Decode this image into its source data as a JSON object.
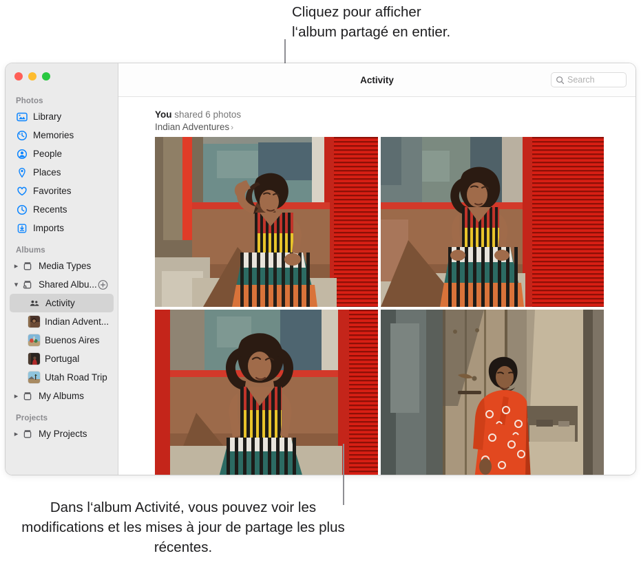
{
  "callouts": {
    "top": "Cliquez pour afficher\nl‘album partagé en entier.",
    "bottom": "Dans l‘album Activité, vous pouvez voir les modifications et les mises à jour de partage les plus récentes."
  },
  "window": {
    "traffic_lights": {
      "close": "close-button",
      "minimize": "minimize-button",
      "zoom": "zoom-button"
    }
  },
  "toolbar": {
    "title": "Activity",
    "search_placeholder": "Search",
    "search_value": ""
  },
  "sidebar": {
    "sections": [
      {
        "title": "Photos",
        "items": [
          {
            "label": "Library",
            "icon": "library-icon"
          },
          {
            "label": "Memories",
            "icon": "memories-icon"
          },
          {
            "label": "People",
            "icon": "people-icon"
          },
          {
            "label": "Places",
            "icon": "places-icon"
          },
          {
            "label": "Favorites",
            "icon": "heart-icon"
          },
          {
            "label": "Recents",
            "icon": "clock-icon"
          },
          {
            "label": "Imports",
            "icon": "import-icon"
          }
        ]
      },
      {
        "title": "Albums",
        "items": [
          {
            "label": "Media Types",
            "icon": "album-box-icon",
            "disclosure": "collapsed"
          },
          {
            "label": "Shared Albu...",
            "icon": "shared-box-icon",
            "disclosure": "expanded",
            "action": "add-shared-album-button"
          },
          {
            "label": "Activity",
            "icon": "people-pair-icon",
            "selected": true
          },
          {
            "label": "Indian Advent...",
            "icon": "album-thumbnail"
          },
          {
            "label": "Buenos Aires",
            "icon": "album-thumbnail"
          },
          {
            "label": "Portugal",
            "icon": "album-thumbnail"
          },
          {
            "label": "Utah Road Trip",
            "icon": "album-thumbnail"
          },
          {
            "label": "My Albums",
            "icon": "album-box-icon",
            "disclosure": "collapsed"
          }
        ]
      },
      {
        "title": "Projects",
        "items": [
          {
            "label": "My Projects",
            "icon": "album-box-icon",
            "disclosure": "collapsed"
          }
        ]
      }
    ]
  },
  "activity": {
    "actor": "You",
    "action": "shared 6 photos",
    "album_link": "Indian Adventures",
    "chevron": "›",
    "photos": [
      {
        "name": "photo-woman-striped-dress-hand-on-head"
      },
      {
        "name": "photo-woman-striped-dress-seated"
      },
      {
        "name": "photo-woman-striped-dress-eyes-closed"
      },
      {
        "name": "photo-man-orange-kurta-doorway"
      }
    ]
  },
  "colors": {
    "accent": "#0a84ff",
    "sidebar_bg": "#ebebeb",
    "selected_row": "#d4d4d4",
    "leader_line": "#8e8e93"
  }
}
